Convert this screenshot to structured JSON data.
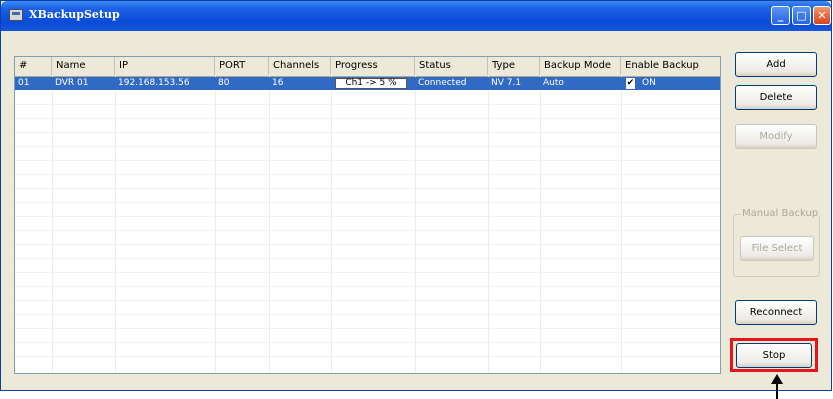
{
  "window": {
    "title": "XBackupSetup"
  },
  "table": {
    "columns": [
      "#",
      "Name",
      "IP",
      "PORT",
      "Channels",
      "Progress",
      "Status",
      "Type",
      "Backup Mode",
      "Enable Backup"
    ],
    "rows": [
      {
        "num": "01",
        "name": "DVR 01",
        "ip": "192.168.153.56",
        "port": "80",
        "channels": "16",
        "progress": "Ch1 -> 5 %",
        "status": "Connected",
        "type": "NV 7.1",
        "backup_mode": "Auto",
        "enable_backup": "ON",
        "enable_checked": true
      }
    ]
  },
  "buttons": {
    "add": "Add",
    "delete": "Delete",
    "modify": "Modify",
    "manual_backup_group": "Manual Backup",
    "file_select": "File Select",
    "reconnect": "Reconnect",
    "stop": "Stop"
  },
  "colors": {
    "selection": "#316ac5",
    "highlight": "#e8141c",
    "titlebar": "#0a4bd6"
  }
}
